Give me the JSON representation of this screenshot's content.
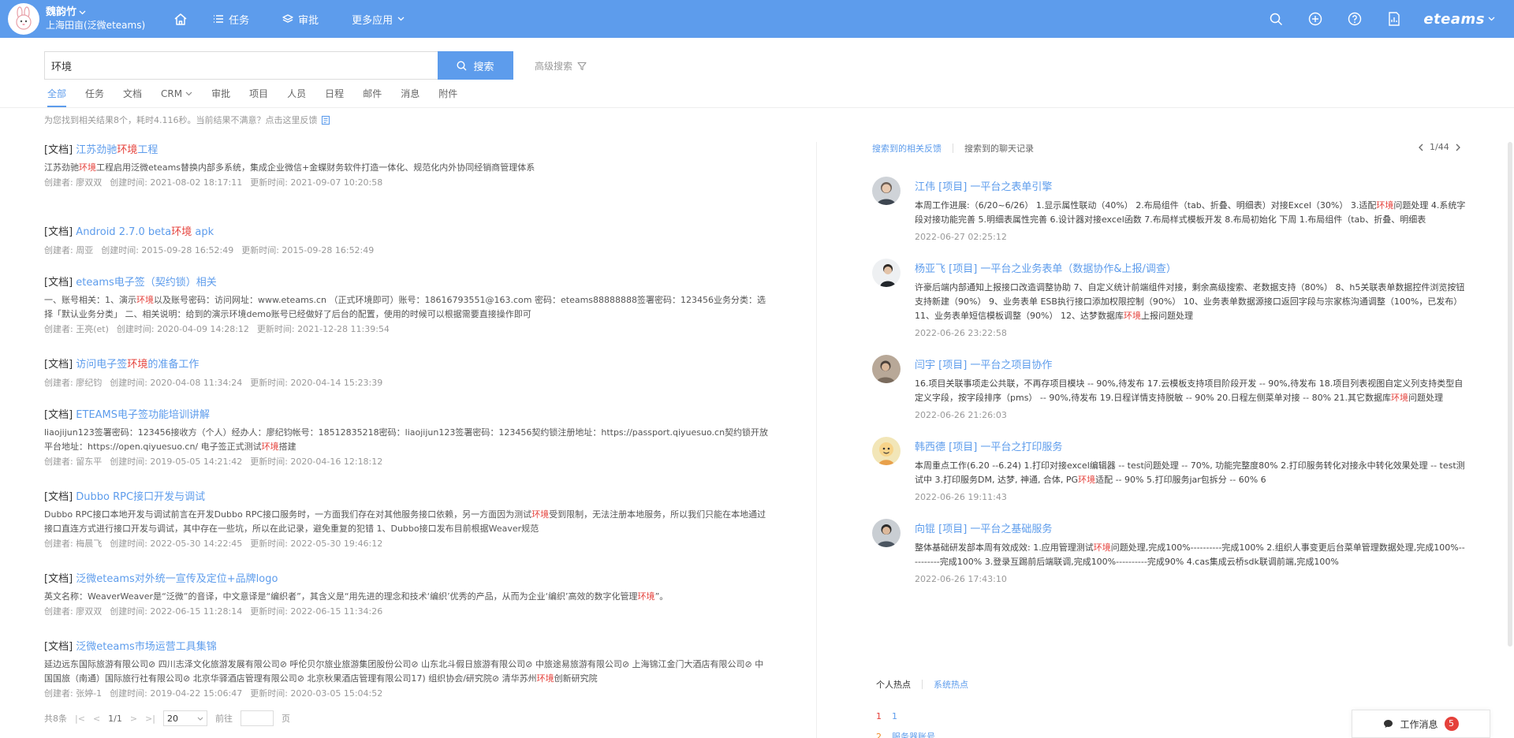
{
  "header": {
    "user_name": "魏韵竹",
    "user_org": "上海田亩(泛微eteams)",
    "nav": [
      {
        "label": "任务"
      },
      {
        "label": "审批"
      },
      {
        "label": "更多应用"
      }
    ],
    "brand": "eteams",
    "bar_color": "#5d9cec"
  },
  "search": {
    "value": "环境",
    "button_label": "搜索",
    "advanced_label": "高级搜索"
  },
  "tabs": [
    "全部",
    "任务",
    "文档",
    "CRM",
    "审批",
    "项目",
    "人员",
    "日程",
    "邮件",
    "消息",
    "附件"
  ],
  "result_info": "为您找到相关结果8个，耗时4.116秒。当前结果不满意？点击这里反馈",
  "results": [
    {
      "type": "[文档]",
      "title": [
        "江苏劲驰",
        "环境",
        "工程"
      ],
      "desc": [
        "江苏劲驰",
        "环境",
        "工程启用泛微eteams替换内部多系统，集成企业微信+金蝶财务软件打造一体化、规范化内外协同经销商管理体系"
      ],
      "creator": "创建者: 廖双双",
      "created": "创建时间: 2021-08-02 18:17:11",
      "updated": "更新时间: 2021-09-07 10:20:58"
    },
    {
      "type": "[文档]",
      "title": [
        "Android 2.7.0 beta",
        "环境",
        " apk"
      ],
      "desc": [
        "",
        "",
        ""
      ],
      "creator": "创建者: 周亚",
      "created": "创建时间: 2015-09-28 16:52:49",
      "updated": "更新时间: 2015-09-28 16:52:49"
    },
    {
      "type": "[文档]",
      "title": [
        "eteams电子签（契约锁）相关",
        "",
        ""
      ],
      "desc": [
        "一、账号相关：1、演示",
        "环境",
        "以及账号密码：访问网址：www.eteams.cn （正式环境即可）账号：18616793551@163.com 密码：eteams88888888签署密码：123456业务分类：选择「默认业务分类」 二、相关说明：给到的演示环境demo账号已经做好了后台的配置，使用的时候可以根据需要直接操作即可"
      ],
      "creator": "创建者: 王亮(et)",
      "created": "创建时间: 2020-04-09 14:28:12",
      "updated": "更新时间: 2021-12-28 11:39:54"
    },
    {
      "type": "[文档]",
      "title": [
        "访问电子签",
        "环境",
        "的准备工作"
      ],
      "desc": [
        "",
        "",
        ""
      ],
      "creator": "创建者: 廖纪钧",
      "created": "创建时间: 2020-04-08 11:34:24",
      "updated": "更新时间: 2020-04-14 15:23:39"
    },
    {
      "type": "[文档]",
      "title": [
        "ETEAMS电子签功能培训讲解",
        "",
        ""
      ],
      "desc": [
        "liaojijun123签署密码：123456接收方（个人）经办人：廖纪钧帐号：18512835218密码：liaojijun123签署密码：123456契约锁注册地址：https://passport.qiyuesuo.cn契约锁开放平台地址：https://open.qiyuesuo.cn/ 电子签正式测试",
        "环境",
        "搭建"
      ],
      "creator": "创建者: 留东平",
      "created": "创建时间: 2019-05-05 14:21:42",
      "updated": "更新时间: 2020-04-16 12:18:12"
    },
    {
      "type": "[文档]",
      "title": [
        "Dubbo RPC接口开发与调试",
        "",
        ""
      ],
      "desc": [
        "Dubbo RPC接口本地开发与调试前言在开发Dubbo RPC接口服务时，一方面我们存在对其他服务接口依赖，另一方面因为测试",
        "环境",
        "受到限制，无法注册本地服务，所以我们只能在本地通过接口直连方式进行接口开发与调试，其中存在一些坑，所以在此记录，避免重复的犯错 1、Dubbo接口发布目前根据Weaver规范"
      ],
      "creator": "创建者: 梅晨飞",
      "created": "创建时间: 2022-05-30 14:22:45",
      "updated": "更新时间: 2022-05-30 19:46:12"
    },
    {
      "type": "[文档]",
      "title": [
        "泛微eteams对外统一宣传及定位+品牌logo",
        "",
        ""
      ],
      "desc": [
        "英文名称：WeaverWeaver是“泛微”的音译，中文意译是“编织者”，其含义是“用先进的理念和技术‘编织’优秀的产品，从而为企业‘编织’高效的数字化管理",
        "环境",
        "”。"
      ],
      "creator": "创建者: 廖双双",
      "created": "创建时间: 2022-06-15 11:28:14",
      "updated": "更新时间: 2022-06-15 11:34:26"
    },
    {
      "type": "[文档]",
      "title": [
        "泛微eteams市场运营工具集锦",
        "",
        ""
      ],
      "desc": [
        "延边远东国际旅游有限公司⊘ 四川志泽文化旅游发展有限公司⊘ 呼伦贝尔旅业旅游集团股份公司⊘ 山东北斗假日旅游有限公司⊘ 中旅途易旅游有限公司⊘ 上海锦江金门大酒店有限公司⊘ 中国国旅（南通）国际旅行社有限公司⊘ 北京华驿酒店管理有限公司⊘ 北京秋果酒店管理有限公司17) 组织协会/研究院⊘ 清华苏州",
        "环境",
        "创新研究院"
      ],
      "creator": "创建者: 张婷-1",
      "created": "创建时间: 2019-04-22 15:06:47",
      "updated": "更新时间: 2020-03-05 15:04:52"
    }
  ],
  "pager": {
    "total": "共8条",
    "page": "1/1",
    "size": "20",
    "goto_label": "前往",
    "page_label": "页"
  },
  "right_panel": {
    "tab_feedback": "搜索到的相关反馈",
    "tab_chat": "搜索到的聊天记录",
    "page": "1/44",
    "feeds": [
      {
        "title": "江伟 [项目] 一平台之表单引擎",
        "desc": [
          "本周工作进展:（6/20~6/26） 1.显示属性联动（40%） 2.布局组件（tab、折叠、明细表）对接Excel（30%） 3.适配",
          "环境",
          "问题处理 4.系统字段对接功能完善 5.明细表属性完善 6.设计器对接excel函数 7.布局样式模板开发 8.布局初始化 下周 1.布局组件（tab、折叠、明细表"
        ],
        "time": "2022-06-27 02:25:12"
      },
      {
        "title": "杨亚飞 [项目] 一平台之业务表单（数据协作&上报/调查）",
        "desc": [
          "许豪后端内部通知上报接口改造调整协助 7、自定义统计前端组件对接，剩余高级搜索、老数据支持（80%） 8、h5关联表单数据控件浏览按钮支持新建（90%） 9、业务表单 ESB执行接口添加权限控制（90%） 10、业务表单数据源接口返回字段与宗家栋沟通调整（100%，已发布） 11、业务表单短信模板调整（90%） 12、达梦数据库",
          "环境",
          "上报问题处理"
        ],
        "time": "2022-06-26 23:22:58"
      },
      {
        "title": "闫宇 [项目] 一平台之项目协作",
        "desc": [
          "16.项目关联事项走公共联，不再存项目模块 -- 90%,待发布 17.云模板支持项目阶段开发 -- 90%,待发布 18.项目列表视图自定义列支持类型自定义字段，按字段排序（pms） -- 90%,待发布 19.日程详情支持脱敏 -- 90% 20.日程左侧菜单对接 -- 80% 21.其它数据库",
          "环境",
          "问题处理"
        ],
        "time": "2022-06-26 21:26:03"
      },
      {
        "title": "韩西德 [项目] 一平台之打印服务",
        "desc": [
          "本周重点工作(6.20 --6.24) 1.打印对接excel编辑器 -- test问题处理 -- 70%, 功能完整度80% 2.打印服务转化对接永中转化效果处理 -- test测试中 3.打印服务DM, 达梦, 神通, 合体, PG",
          "环境",
          "适配 -- 90% 5.打印服务jar包拆分 -- 60% 6"
        ],
        "time": "2022-06-26 19:11:43"
      },
      {
        "title": "向锟 [项目] 一平台之基础服务",
        "desc": [
          "整体基础研发部本周有效成效: 1.应用管理测试",
          "环境",
          "问题处理,完成100%----------完成100% 2.组织人事变更后台菜单管理数据处理,完成100%----------完成100% 3.登录互踢前后端联调,完成100%----------完成90% 4.cas集成云桥sdk联调前端,完成100%"
        ],
        "time": "2022-06-26 17:43:10"
      }
    ]
  },
  "hot": {
    "tab_personal": "个人热点",
    "tab_system": "系统热点",
    "items": [
      {
        "num": "1",
        "text": "1"
      },
      {
        "num": "2",
        "text": "服务器账号"
      }
    ]
  },
  "work_msg": {
    "label": "工作消息",
    "count": "5"
  }
}
